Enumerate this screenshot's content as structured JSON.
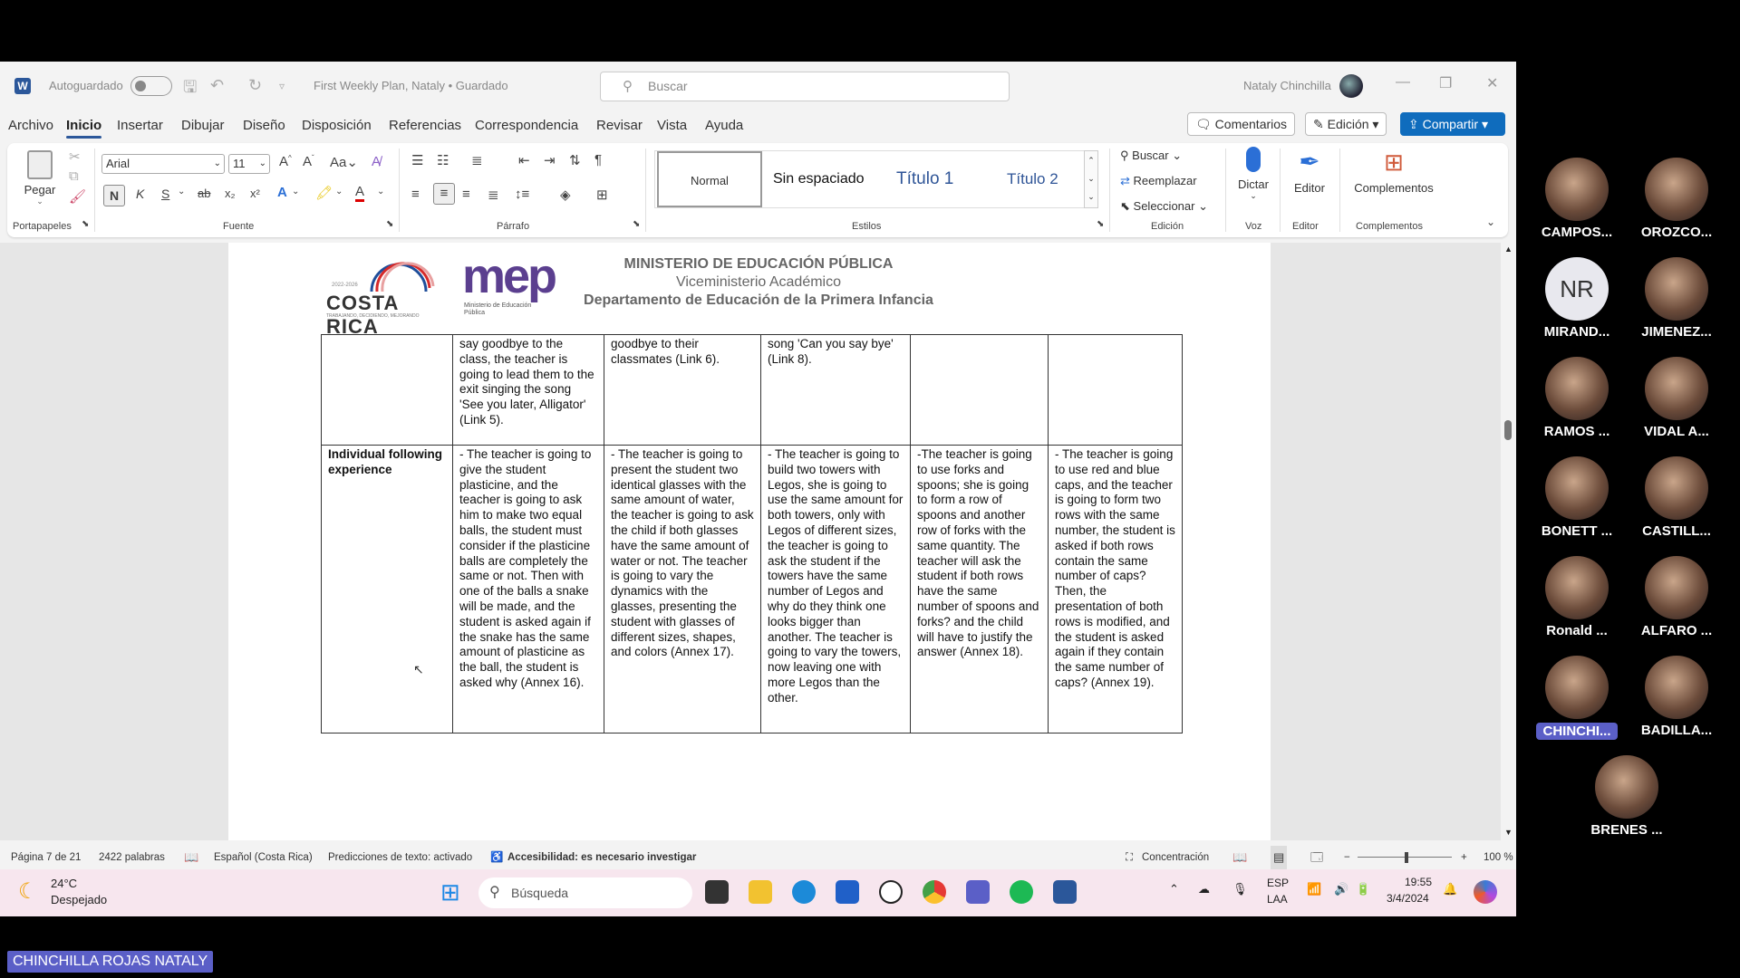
{
  "titlebar": {
    "autosave_label": "Autoguardado",
    "document_title": "First Weekly Plan, Nataly • Guardado",
    "search_placeholder": "Buscar",
    "user_name": "Nataly Chinchilla"
  },
  "menu": {
    "tabs": [
      "Archivo",
      "Inicio",
      "Insertar",
      "Dibujar",
      "Diseño",
      "Disposición",
      "Referencias",
      "Correspondencia",
      "Revisar",
      "Vista",
      "Ayuda"
    ],
    "active_tab": "Inicio",
    "comments_label": "Comentarios",
    "edit_mode_label": "Edición",
    "share_label": "Compartir"
  },
  "ribbon": {
    "paste_label": "Pegar",
    "font_name": "Arial",
    "font_size": "11",
    "bold_label": "N",
    "italic_label": "K",
    "underline_label": "S",
    "styles": [
      "Normal",
      "Sin espaciado",
      "Título 1",
      "Título 2"
    ],
    "find_label": "Buscar",
    "replace_label": "Reemplazar",
    "select_label": "Seleccionar",
    "dictate_label": "Dictar",
    "editor_label": "Editor",
    "addins_label": "Complementos",
    "groups": {
      "clipboard": "Portapapeles",
      "font": "Fuente",
      "paragraph": "Párrafo",
      "styles": "Estilos",
      "editing": "Edición",
      "voice": "Voz",
      "editor": "Editor",
      "addins": "Complementos"
    }
  },
  "document_header": {
    "cr_years": "2022-2026",
    "cr_logo": "COSTA RICA",
    "cr_slogan": "TRABAJANDO, DECIDIENDO, MEJORANDO",
    "mep_logo": "mep",
    "mep_sub": "Ministerio de Educación Pública",
    "line1": "MINISTERIO DE EDUCACIÓN PÚBLICA",
    "line2": "Viceministerio Académico",
    "line3": "Departamento de Educación de la Primera Infancia"
  },
  "table": {
    "row1": [
      "",
      "say goodbye to the class, the teacher is going to lead them to the exit singing the song 'See you later, Alligator' (Link 5).",
      "goodbye to their classmates (Link 6).",
      "song 'Can you say bye' (Link 8).",
      "",
      ""
    ],
    "row2": [
      "Individual following experience",
      "- The teacher is going to give the student plasticine, and the teacher is going to ask him to make two equal balls, the student must consider if the plasticine balls are completely the same or not. Then with one of the balls a snake will be made, and the student is asked again if the snake has the same amount of plasticine as the ball, the student is asked why (Annex 16).",
      "- The teacher is going to present the student two identical glasses with the same amount of water, the teacher is going to ask the child if both glasses have the same amount of water or not. The teacher is going to vary the dynamics with the glasses, presenting the student with glasses of different sizes, shapes, and colors (Annex 17).",
      "- The teacher is going to build two towers with Legos, she is going to use the same amount for both towers, only with Legos of different sizes, the teacher is going to ask the student if the towers have the same number of Legos and why do they think one looks bigger than another. The teacher is going to vary the towers, now leaving one with more Legos than the other.",
      "-The teacher is going to use forks and spoons; she is going to form a row of spoons and another row of forks with the same quantity. The teacher will ask the student if both rows have the same number of spoons and forks? and the child will have to justify the answer (Annex 18).",
      "- The teacher is going to use red and blue caps, and the teacher is going to form two rows with the same number, the student is asked if both rows contain the same number of caps? Then, the presentation of both rows is modified, and the student is asked again if they contain the same number of caps? (Annex 19)."
    ]
  },
  "statusbar": {
    "page": "Página 7 de 21",
    "words": "2422 palabras",
    "language": "Español (Costa Rica)",
    "predictions": "Predicciones de texto: activado",
    "accessibility": "Accesibilidad: es necesario investigar",
    "focus": "Concentración",
    "zoom": "100 %"
  },
  "taskbar": {
    "temperature": "24°C",
    "weather": "Despejado",
    "search_placeholder": "Búsqueda",
    "lang1": "ESP",
    "lang2": "LAA",
    "time": "19:55",
    "date": "3/4/2024"
  },
  "participants": [
    {
      "name": "CAMPOS..."
    },
    {
      "name": "OROZCO..."
    },
    {
      "name": "MIRAND...",
      "initials": "NR"
    },
    {
      "name": "JIMENEZ..."
    },
    {
      "name": "RAMOS ..."
    },
    {
      "name": "VIDAL A..."
    },
    {
      "name": "BONETT ..."
    },
    {
      "name": "CASTILL..."
    },
    {
      "name": "Ronald ..."
    },
    {
      "name": "ALFARO ..."
    },
    {
      "name": "CHINCHI..."
    },
    {
      "name": "BADILLA..."
    },
    {
      "name": "BRENES ..."
    }
  ],
  "presenter_name": "CHINCHILLA ROJAS NATALY",
  "colors": {
    "word_blue": "#2b579a",
    "share_blue": "#0f6cbd",
    "teams_purple": "#5b5fc7"
  }
}
